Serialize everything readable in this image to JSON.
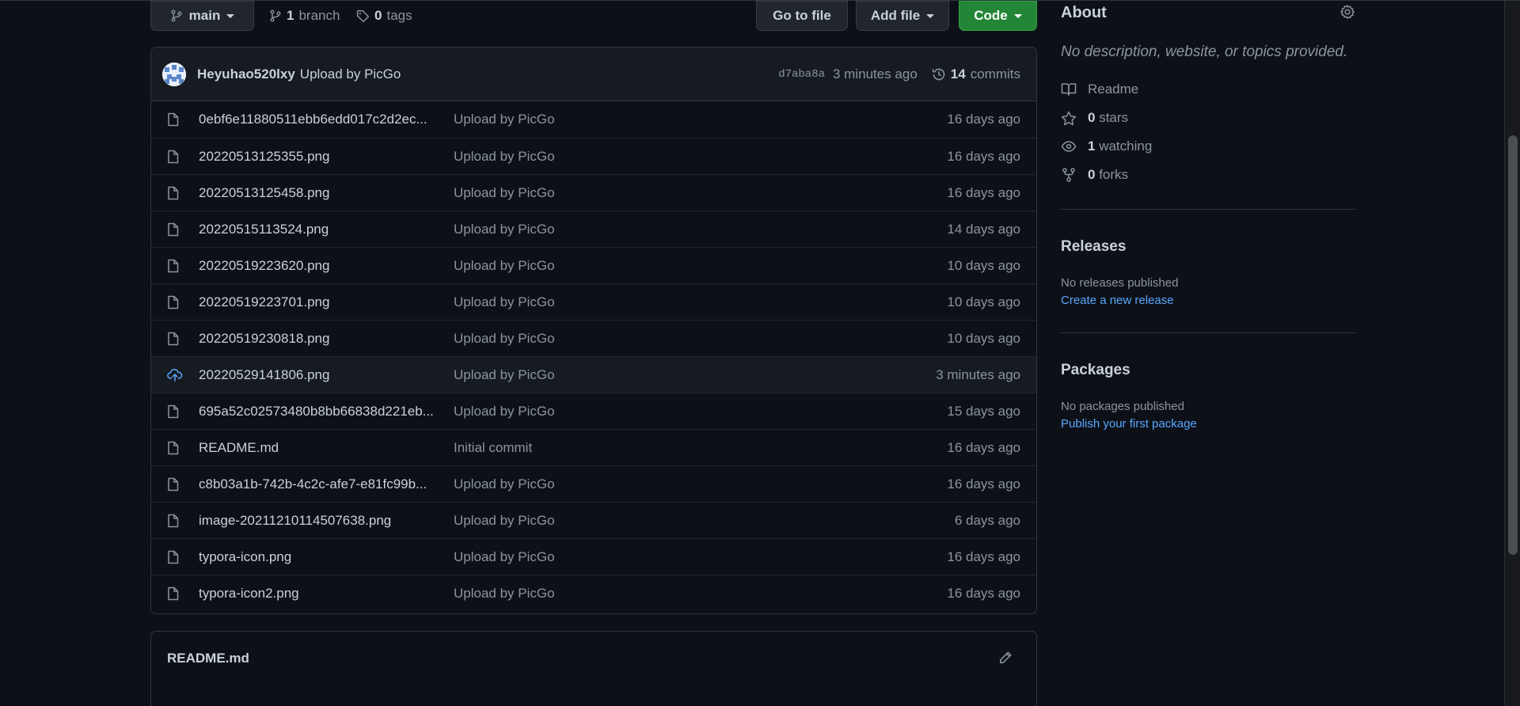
{
  "toolbar": {
    "branch_label": "main",
    "branch_count": "1",
    "branch_word": "branch",
    "tag_count": "0",
    "tag_word": "tags",
    "goto_file": "Go to file",
    "add_file": "Add file",
    "code": "Code"
  },
  "commit": {
    "author": "Heyuhao520lxy",
    "message": "Upload by PicGo",
    "hash": "d7aba8a",
    "time": "3 minutes ago",
    "count": "14",
    "count_word": "commits"
  },
  "files": [
    {
      "name": "0ebf6e11880511ebb6edd017c2d2ec...",
      "message": "Upload by PicGo",
      "age": "16 days ago",
      "icon": "file-icon"
    },
    {
      "name": "20220513125355.png",
      "message": "Upload by PicGo",
      "age": "16 days ago",
      "icon": "file-icon"
    },
    {
      "name": "20220513125458.png",
      "message": "Upload by PicGo",
      "age": "16 days ago",
      "icon": "file-icon"
    },
    {
      "name": "20220515113524.png",
      "message": "Upload by PicGo",
      "age": "14 days ago",
      "icon": "file-icon"
    },
    {
      "name": "20220519223620.png",
      "message": "Upload by PicGo",
      "age": "10 days ago",
      "icon": "file-icon"
    },
    {
      "name": "20220519223701.png",
      "message": "Upload by PicGo",
      "age": "10 days ago",
      "icon": "file-icon"
    },
    {
      "name": "20220519230818.png",
      "message": "Upload by PicGo",
      "age": "10 days ago",
      "icon": "file-icon"
    },
    {
      "name": "20220529141806.png",
      "message": "Upload by PicGo",
      "age": "3 minutes ago",
      "icon": "cloud-upload-icon"
    },
    {
      "name": "695a52c02573480b8bb66838d221eb...",
      "message": "Upload by PicGo",
      "age": "15 days ago",
      "icon": "file-icon"
    },
    {
      "name": "README.md",
      "message": "Initial commit",
      "age": "16 days ago",
      "icon": "file-icon"
    },
    {
      "name": "c8b03a1b-742b-4c2c-afe7-e81fc99b...",
      "message": "Upload by PicGo",
      "age": "16 days ago",
      "icon": "file-icon"
    },
    {
      "name": "image-20211210114507638.png",
      "message": "Upload by PicGo",
      "age": "6 days ago",
      "icon": "file-icon"
    },
    {
      "name": "typora-icon.png",
      "message": "Upload by PicGo",
      "age": "16 days ago",
      "icon": "file-icon"
    },
    {
      "name": "typora-icon2.png",
      "message": "Upload by PicGo",
      "age": "16 days ago",
      "icon": "file-icon"
    }
  ],
  "readme": {
    "title": "README.md"
  },
  "about": {
    "heading": "About",
    "description": "No description, website, or topics provided.",
    "readme_label": "Readme",
    "stars_count": "0",
    "stars_word": "stars",
    "watching_count": "1",
    "watching_word": "watching",
    "forks_count": "0",
    "forks_word": "forks"
  },
  "releases": {
    "heading": "Releases",
    "empty": "No releases published",
    "link": "Create a new release"
  },
  "packages": {
    "heading": "Packages",
    "empty": "No packages published",
    "link": "Publish your first package"
  },
  "colors": {
    "background": "#0d1117",
    "code_button": "#238636",
    "link": "#58a6ff",
    "muted_text": "#8b949e"
  }
}
